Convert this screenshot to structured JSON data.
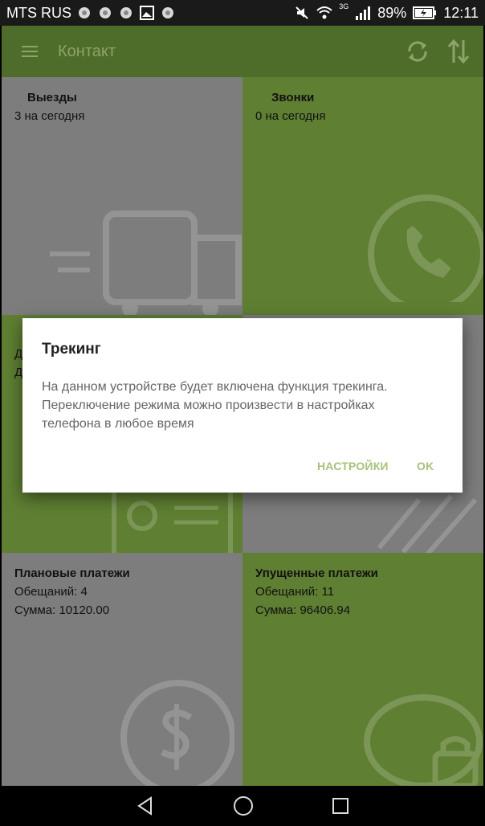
{
  "status_bar": {
    "carrier": "MTS RUS",
    "battery_percent": "89%",
    "network_type": "3G",
    "time": "12:11",
    "icons": [
      "notification-icon",
      "notification-icon",
      "notification-icon",
      "gallery-icon",
      "notification-icon",
      "mute-icon",
      "wifi-icon",
      "signal-icon",
      "battery-icon"
    ]
  },
  "app_bar": {
    "title": "Контакт",
    "icons": [
      "menu-icon",
      "sync-icon",
      "sort-icon"
    ]
  },
  "tiles": {
    "trips": {
      "title": "Выезды",
      "line1": "3 на сегодня",
      "icon": "truck-icon"
    },
    "calls": {
      "title": "Звонки",
      "line1": "0 на сегодня",
      "icon": "phone-icon"
    },
    "partial_left": {
      "line1": "Д",
      "line2": "Д",
      "icon": "id-card-icon"
    },
    "partial_right": {
      "icon": "document-icon"
    },
    "planned": {
      "title": "Плановые платежи",
      "line1": "Обещаний: 4",
      "line2": "Сумма: 10120.00",
      "icon": "dollar-icon"
    },
    "missed": {
      "title": "Упущенные платежи",
      "line1": "Обещаний: 11",
      "line2": "Сумма: 96406.94",
      "icon": "piggy-bank-icon"
    }
  },
  "dialog": {
    "title": "Трекинг",
    "message": "На данном устройстве будет включена функция трекинга. Переключение режима можно произвести в настройках телефона в любое время",
    "settings_label": "НАСТРОЙКИ",
    "ok_label": "OK"
  },
  "nav_bar": {
    "icons": [
      "back-icon",
      "home-icon",
      "recents-icon"
    ]
  },
  "colors": {
    "app_bar": "#4f6d2a",
    "tile_green": "#5f7f32",
    "tile_gray": "#7d7d7d",
    "accent": "#a6c27a"
  }
}
